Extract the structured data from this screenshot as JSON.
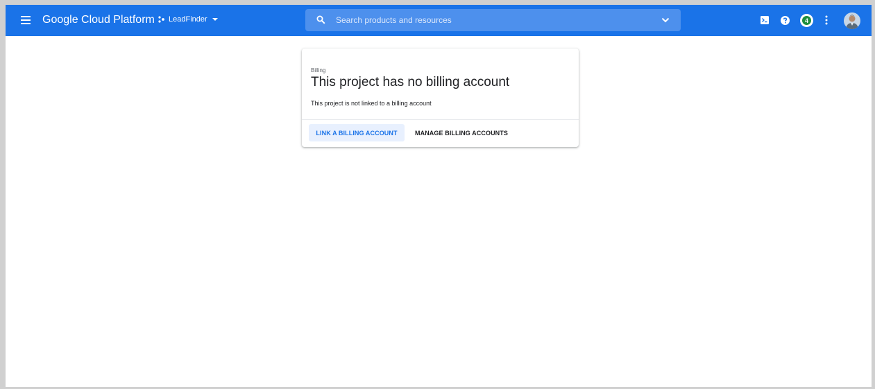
{
  "topbar": {
    "app_title": "Google Cloud Platform",
    "project_name": "LeadFinder",
    "search_placeholder": "Search products and resources",
    "notification_count": "4",
    "brand_color": "#1a73e8"
  },
  "icons": {
    "menu": "hamburger-menu-icon",
    "project": "project-dots-icon",
    "search": "search-icon",
    "shell": "cloud-shell-icon",
    "help": "help-icon",
    "notifications": "notifications-icon",
    "more": "more-vert-icon",
    "avatar": "user-avatar"
  },
  "card": {
    "label": "Billing",
    "title": "This project has no billing account",
    "subtitle": "This project is not linked to a billing account",
    "link_button": "LINK A BILLING ACCOUNT",
    "manage_button": "MANAGE BILLING ACCOUNTS"
  }
}
